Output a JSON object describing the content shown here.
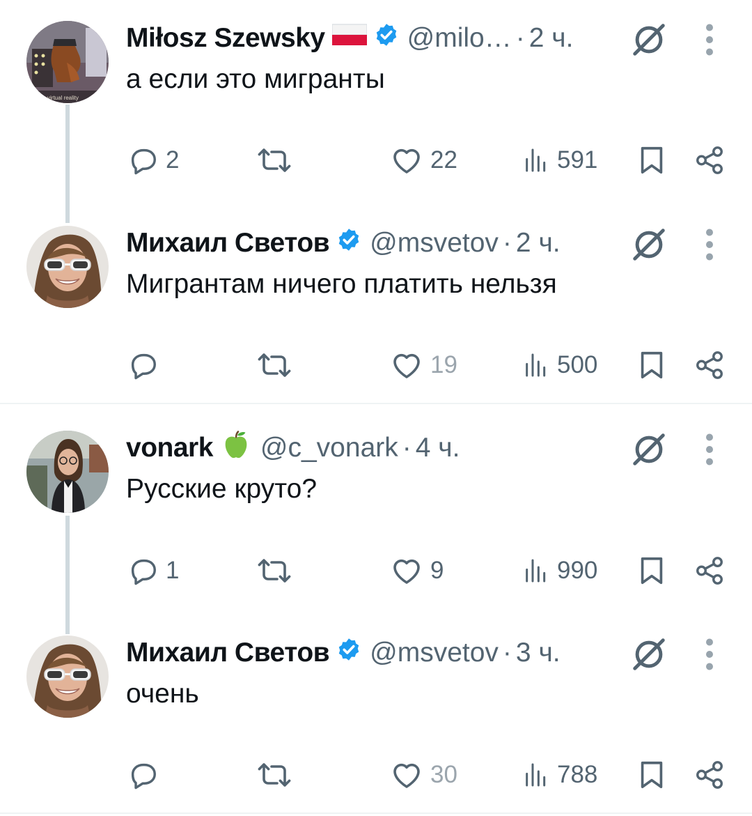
{
  "colors": {
    "text": "#0f1419",
    "secondary": "#536471",
    "verified": "#1d9bf0",
    "thread_line": "#cfd9de",
    "divider": "#eff3f4"
  },
  "tweets": [
    {
      "name": "Miłosz Szewsky",
      "badge": "flag-poland",
      "verified": true,
      "handle": "@milo…",
      "dot": "·",
      "time": "2 ч.",
      "text": "а если это мигранты",
      "avatar_caption": "virtual reality",
      "replies": "2",
      "retweets": "",
      "likes": "22",
      "views": "591"
    },
    {
      "name": "Михаил Светов",
      "verified": true,
      "handle": "@msvetov",
      "dot": "·",
      "time": "2 ч.",
      "text": "Мигрантам ничего платить нельзя",
      "replies": "",
      "retweets": "",
      "likes": "19",
      "views": "500"
    },
    {
      "name": "vonark",
      "badge": "green-apple",
      "verified": false,
      "handle": "@c_vonark",
      "dot": "·",
      "time": "4 ч.",
      "text": "Русские круто?",
      "replies": "1",
      "retweets": "",
      "likes": "9",
      "views": "990"
    },
    {
      "name": "Михаил Светов",
      "verified": true,
      "handle": "@msvetov",
      "dot": "·",
      "time": "3 ч.",
      "text": "очень",
      "replies": "",
      "retweets": "",
      "likes": "30",
      "views": "788"
    }
  ],
  "icons": [
    "reply-icon",
    "retweet-icon",
    "like-icon",
    "views-icon",
    "bookmark-icon",
    "share-icon",
    "grok-icon",
    "more-icon",
    "verified-icon"
  ]
}
